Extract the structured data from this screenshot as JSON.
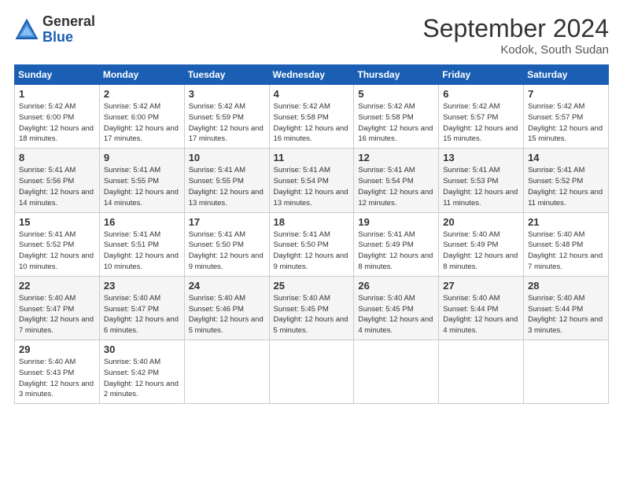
{
  "header": {
    "logo_general": "General",
    "logo_blue": "Blue",
    "month_title": "September 2024",
    "location": "Kodok, South Sudan"
  },
  "weekdays": [
    "Sunday",
    "Monday",
    "Tuesday",
    "Wednesday",
    "Thursday",
    "Friday",
    "Saturday"
  ],
  "weeks": [
    [
      {
        "day": "1",
        "sunrise": "5:42 AM",
        "sunset": "6:00 PM",
        "daylight": "12 hours and 18 minutes."
      },
      {
        "day": "2",
        "sunrise": "5:42 AM",
        "sunset": "6:00 PM",
        "daylight": "12 hours and 17 minutes."
      },
      {
        "day": "3",
        "sunrise": "5:42 AM",
        "sunset": "5:59 PM",
        "daylight": "12 hours and 17 minutes."
      },
      {
        "day": "4",
        "sunrise": "5:42 AM",
        "sunset": "5:58 PM",
        "daylight": "12 hours and 16 minutes."
      },
      {
        "day": "5",
        "sunrise": "5:42 AM",
        "sunset": "5:58 PM",
        "daylight": "12 hours and 16 minutes."
      },
      {
        "day": "6",
        "sunrise": "5:42 AM",
        "sunset": "5:57 PM",
        "daylight": "12 hours and 15 minutes."
      },
      {
        "day": "7",
        "sunrise": "5:42 AM",
        "sunset": "5:57 PM",
        "daylight": "12 hours and 15 minutes."
      }
    ],
    [
      {
        "day": "8",
        "sunrise": "5:41 AM",
        "sunset": "5:56 PM",
        "daylight": "12 hours and 14 minutes."
      },
      {
        "day": "9",
        "sunrise": "5:41 AM",
        "sunset": "5:55 PM",
        "daylight": "12 hours and 14 minutes."
      },
      {
        "day": "10",
        "sunrise": "5:41 AM",
        "sunset": "5:55 PM",
        "daylight": "12 hours and 13 minutes."
      },
      {
        "day": "11",
        "sunrise": "5:41 AM",
        "sunset": "5:54 PM",
        "daylight": "12 hours and 13 minutes."
      },
      {
        "day": "12",
        "sunrise": "5:41 AM",
        "sunset": "5:54 PM",
        "daylight": "12 hours and 12 minutes."
      },
      {
        "day": "13",
        "sunrise": "5:41 AM",
        "sunset": "5:53 PM",
        "daylight": "12 hours and 11 minutes."
      },
      {
        "day": "14",
        "sunrise": "5:41 AM",
        "sunset": "5:52 PM",
        "daylight": "12 hours and 11 minutes."
      }
    ],
    [
      {
        "day": "15",
        "sunrise": "5:41 AM",
        "sunset": "5:52 PM",
        "daylight": "12 hours and 10 minutes."
      },
      {
        "day": "16",
        "sunrise": "5:41 AM",
        "sunset": "5:51 PM",
        "daylight": "12 hours and 10 minutes."
      },
      {
        "day": "17",
        "sunrise": "5:41 AM",
        "sunset": "5:50 PM",
        "daylight": "12 hours and 9 minutes."
      },
      {
        "day": "18",
        "sunrise": "5:41 AM",
        "sunset": "5:50 PM",
        "daylight": "12 hours and 9 minutes."
      },
      {
        "day": "19",
        "sunrise": "5:41 AM",
        "sunset": "5:49 PM",
        "daylight": "12 hours and 8 minutes."
      },
      {
        "day": "20",
        "sunrise": "5:40 AM",
        "sunset": "5:49 PM",
        "daylight": "12 hours and 8 minutes."
      },
      {
        "day": "21",
        "sunrise": "5:40 AM",
        "sunset": "5:48 PM",
        "daylight": "12 hours and 7 minutes."
      }
    ],
    [
      {
        "day": "22",
        "sunrise": "5:40 AM",
        "sunset": "5:47 PM",
        "daylight": "12 hours and 7 minutes."
      },
      {
        "day": "23",
        "sunrise": "5:40 AM",
        "sunset": "5:47 PM",
        "daylight": "12 hours and 6 minutes."
      },
      {
        "day": "24",
        "sunrise": "5:40 AM",
        "sunset": "5:46 PM",
        "daylight": "12 hours and 5 minutes."
      },
      {
        "day": "25",
        "sunrise": "5:40 AM",
        "sunset": "5:45 PM",
        "daylight": "12 hours and 5 minutes."
      },
      {
        "day": "26",
        "sunrise": "5:40 AM",
        "sunset": "5:45 PM",
        "daylight": "12 hours and 4 minutes."
      },
      {
        "day": "27",
        "sunrise": "5:40 AM",
        "sunset": "5:44 PM",
        "daylight": "12 hours and 4 minutes."
      },
      {
        "day": "28",
        "sunrise": "5:40 AM",
        "sunset": "5:44 PM",
        "daylight": "12 hours and 3 minutes."
      }
    ],
    [
      {
        "day": "29",
        "sunrise": "5:40 AM",
        "sunset": "5:43 PM",
        "daylight": "12 hours and 3 minutes."
      },
      {
        "day": "30",
        "sunrise": "5:40 AM",
        "sunset": "5:42 PM",
        "daylight": "12 hours and 2 minutes."
      },
      null,
      null,
      null,
      null,
      null
    ]
  ]
}
